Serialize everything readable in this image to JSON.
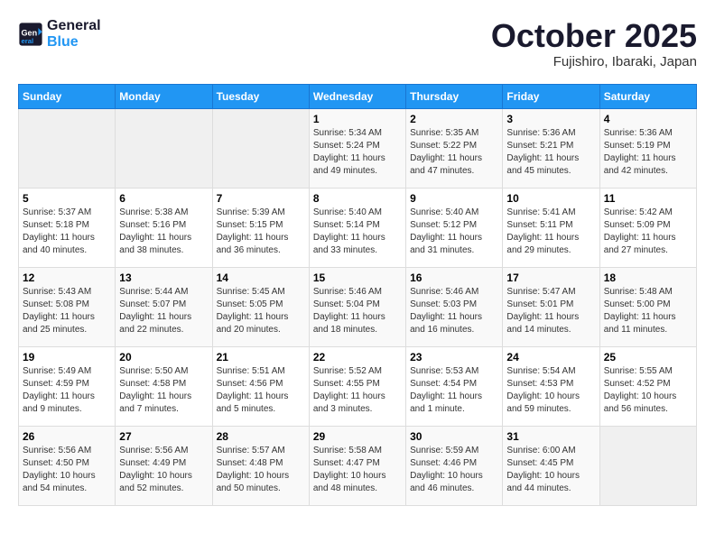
{
  "header": {
    "logo_line1": "General",
    "logo_line2": "Blue",
    "month": "October 2025",
    "location": "Fujishiro, Ibaraki, Japan"
  },
  "weekdays": [
    "Sunday",
    "Monday",
    "Tuesday",
    "Wednesday",
    "Thursday",
    "Friday",
    "Saturday"
  ],
  "weeks": [
    [
      {
        "day": "",
        "info": ""
      },
      {
        "day": "",
        "info": ""
      },
      {
        "day": "",
        "info": ""
      },
      {
        "day": "1",
        "info": "Sunrise: 5:34 AM\nSunset: 5:24 PM\nDaylight: 11 hours\nand 49 minutes."
      },
      {
        "day": "2",
        "info": "Sunrise: 5:35 AM\nSunset: 5:22 PM\nDaylight: 11 hours\nand 47 minutes."
      },
      {
        "day": "3",
        "info": "Sunrise: 5:36 AM\nSunset: 5:21 PM\nDaylight: 11 hours\nand 45 minutes."
      },
      {
        "day": "4",
        "info": "Sunrise: 5:36 AM\nSunset: 5:19 PM\nDaylight: 11 hours\nand 42 minutes."
      }
    ],
    [
      {
        "day": "5",
        "info": "Sunrise: 5:37 AM\nSunset: 5:18 PM\nDaylight: 11 hours\nand 40 minutes."
      },
      {
        "day": "6",
        "info": "Sunrise: 5:38 AM\nSunset: 5:16 PM\nDaylight: 11 hours\nand 38 minutes."
      },
      {
        "day": "7",
        "info": "Sunrise: 5:39 AM\nSunset: 5:15 PM\nDaylight: 11 hours\nand 36 minutes."
      },
      {
        "day": "8",
        "info": "Sunrise: 5:40 AM\nSunset: 5:14 PM\nDaylight: 11 hours\nand 33 minutes."
      },
      {
        "day": "9",
        "info": "Sunrise: 5:40 AM\nSunset: 5:12 PM\nDaylight: 11 hours\nand 31 minutes."
      },
      {
        "day": "10",
        "info": "Sunrise: 5:41 AM\nSunset: 5:11 PM\nDaylight: 11 hours\nand 29 minutes."
      },
      {
        "day": "11",
        "info": "Sunrise: 5:42 AM\nSunset: 5:09 PM\nDaylight: 11 hours\nand 27 minutes."
      }
    ],
    [
      {
        "day": "12",
        "info": "Sunrise: 5:43 AM\nSunset: 5:08 PM\nDaylight: 11 hours\nand 25 minutes."
      },
      {
        "day": "13",
        "info": "Sunrise: 5:44 AM\nSunset: 5:07 PM\nDaylight: 11 hours\nand 22 minutes."
      },
      {
        "day": "14",
        "info": "Sunrise: 5:45 AM\nSunset: 5:05 PM\nDaylight: 11 hours\nand 20 minutes."
      },
      {
        "day": "15",
        "info": "Sunrise: 5:46 AM\nSunset: 5:04 PM\nDaylight: 11 hours\nand 18 minutes."
      },
      {
        "day": "16",
        "info": "Sunrise: 5:46 AM\nSunset: 5:03 PM\nDaylight: 11 hours\nand 16 minutes."
      },
      {
        "day": "17",
        "info": "Sunrise: 5:47 AM\nSunset: 5:01 PM\nDaylight: 11 hours\nand 14 minutes."
      },
      {
        "day": "18",
        "info": "Sunrise: 5:48 AM\nSunset: 5:00 PM\nDaylight: 11 hours\nand 11 minutes."
      }
    ],
    [
      {
        "day": "19",
        "info": "Sunrise: 5:49 AM\nSunset: 4:59 PM\nDaylight: 11 hours\nand 9 minutes."
      },
      {
        "day": "20",
        "info": "Sunrise: 5:50 AM\nSunset: 4:58 PM\nDaylight: 11 hours\nand 7 minutes."
      },
      {
        "day": "21",
        "info": "Sunrise: 5:51 AM\nSunset: 4:56 PM\nDaylight: 11 hours\nand 5 minutes."
      },
      {
        "day": "22",
        "info": "Sunrise: 5:52 AM\nSunset: 4:55 PM\nDaylight: 11 hours\nand 3 minutes."
      },
      {
        "day": "23",
        "info": "Sunrise: 5:53 AM\nSunset: 4:54 PM\nDaylight: 11 hours\nand 1 minute."
      },
      {
        "day": "24",
        "info": "Sunrise: 5:54 AM\nSunset: 4:53 PM\nDaylight: 10 hours\nand 59 minutes."
      },
      {
        "day": "25",
        "info": "Sunrise: 5:55 AM\nSunset: 4:52 PM\nDaylight: 10 hours\nand 56 minutes."
      }
    ],
    [
      {
        "day": "26",
        "info": "Sunrise: 5:56 AM\nSunset: 4:50 PM\nDaylight: 10 hours\nand 54 minutes."
      },
      {
        "day": "27",
        "info": "Sunrise: 5:56 AM\nSunset: 4:49 PM\nDaylight: 10 hours\nand 52 minutes."
      },
      {
        "day": "28",
        "info": "Sunrise: 5:57 AM\nSunset: 4:48 PM\nDaylight: 10 hours\nand 50 minutes."
      },
      {
        "day": "29",
        "info": "Sunrise: 5:58 AM\nSunset: 4:47 PM\nDaylight: 10 hours\nand 48 minutes."
      },
      {
        "day": "30",
        "info": "Sunrise: 5:59 AM\nSunset: 4:46 PM\nDaylight: 10 hours\nand 46 minutes."
      },
      {
        "day": "31",
        "info": "Sunrise: 6:00 AM\nSunset: 4:45 PM\nDaylight: 10 hours\nand 44 minutes."
      },
      {
        "day": "",
        "info": ""
      }
    ]
  ]
}
